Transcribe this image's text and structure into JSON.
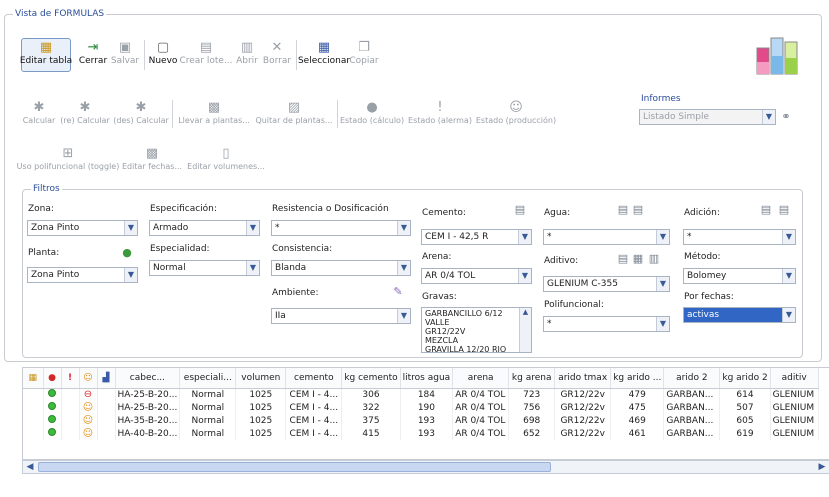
{
  "panel_title": "Vista de FORMULAS",
  "toolbar1": [
    {
      "label": "Editar tabla",
      "icon": "table-icon",
      "enabled": true
    },
    {
      "label": "Cerrar",
      "icon": "close-icon",
      "enabled": true
    },
    {
      "label": "Salvar",
      "icon": "save-icon",
      "enabled": false
    },
    {
      "label": "Nuevo",
      "icon": "new-document-icon",
      "enabled": true
    },
    {
      "label": "Crear lote...",
      "icon": "batch-icon",
      "enabled": false
    },
    {
      "label": "Abrir",
      "icon": "open-icon",
      "enabled": false
    },
    {
      "label": "Borrar",
      "icon": "delete-icon",
      "enabled": false
    },
    {
      "label": "Seleccionar",
      "icon": "select-icon",
      "enabled": true
    },
    {
      "label": "Copiar",
      "icon": "copy-icon",
      "enabled": false
    }
  ],
  "toolbar2": [
    "Calcular",
    "(re) Calcular",
    "(des) Calcular",
    "Llevar a plantas...",
    "Quitar de plantas...",
    "Estado (cálculo)",
    "Estado (alerma)",
    "Estado (producción)"
  ],
  "toolbar3": [
    "Uso polifuncional (toggle)",
    "Editar fechas...",
    "Editar volumenes..."
  ],
  "informes": {
    "title": "Informes",
    "value": "Listado Simple"
  },
  "filtros": {
    "title": "Filtros",
    "zona": {
      "label": "Zona:",
      "value": "Zona Pinto"
    },
    "planta": {
      "label": "Planta:",
      "value": "Zona Pinto"
    },
    "especificacion": {
      "label": "Especificación:",
      "value": "Armado"
    },
    "especialidad": {
      "label": "Especialidad:",
      "value": "Normal"
    },
    "resistencia": {
      "label": "Resistencia o Dosificación",
      "value": "*"
    },
    "consistencia": {
      "label": "Consistencia:",
      "value": "Blanda"
    },
    "ambiente": {
      "label": "Ambiente:",
      "value": "IIa"
    },
    "cemento": {
      "label": "Cemento:",
      "value": "CEM I - 42,5 R"
    },
    "arena": {
      "label": "Arena:",
      "value": "AR 0/4 TOL"
    },
    "gravas": {
      "label": "Gravas:",
      "items": [
        "GARBANCILLO 6/12 VALLE",
        "GR12/22V",
        "MEZCLA",
        "GRAVILLA 12/20 RIO"
      ]
    },
    "agua": {
      "label": "Agua:",
      "value": "*"
    },
    "aditivo": {
      "label": "Aditivo:",
      "value": "GLENIUM C-355"
    },
    "polifuncional": {
      "label": "Polifuncional:",
      "value": "*"
    },
    "adicion": {
      "label": "Adición:",
      "value": "*"
    },
    "metodo": {
      "label": "Método:",
      "value": "Bolomey"
    },
    "por_fechas": {
      "label": "Por fechas:",
      "value": "activas"
    }
  },
  "table": {
    "columns": [
      "cabec...",
      "especiali...",
      "volumen",
      "cemento",
      "kg cemento",
      "litros agua",
      "arena",
      "kg arena",
      "arido tmax",
      "kg arido ...",
      "arido 2",
      "kg arido 2",
      "aditiv"
    ],
    "rows": [
      [
        "HA-25-B-20...",
        "Normal",
        "1025",
        "CEM I - 4...",
        "306",
        "184",
        "AR 0/4 TOL",
        "723",
        "GR12/22v",
        "479",
        "GARBAN...",
        "614",
        "GLENIUM"
      ],
      [
        "HA-25-B-20...",
        "Normal",
        "1025",
        "CEM I - 4...",
        "322",
        "190",
        "AR 0/4 TOL",
        "756",
        "GR12/22v",
        "475",
        "GARBAN...",
        "507",
        "GLENIUM"
      ],
      [
        "HA-35-B-20...",
        "Normal",
        "1025",
        "CEM I - 4...",
        "375",
        "193",
        "AR 0/4 TOL",
        "698",
        "GR12/22v",
        "469",
        "GARBAN...",
        "605",
        "GLENIUM"
      ],
      [
        "HA-40-B-20...",
        "Normal",
        "1025",
        "CEM I - 4...",
        "415",
        "193",
        "AR 0/4 TOL",
        "652",
        "GR12/22v",
        "461",
        "GARBAN...",
        "619",
        "GLENIUM"
      ]
    ],
    "row_status": [
      "stop",
      "smile",
      "smile",
      "smile"
    ]
  }
}
